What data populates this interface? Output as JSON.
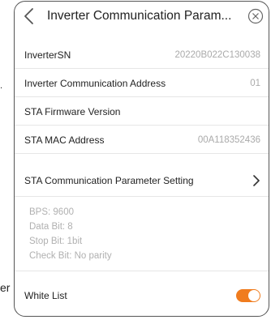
{
  "edge": {
    "dot": ".",
    "r": "er"
  },
  "header": {
    "title": "Inverter Communication Param..."
  },
  "rows": {
    "sn": {
      "label": "InverterSN",
      "value": "20220B022C130038"
    },
    "address": {
      "label": "Inverter Communication Address",
      "value": "01"
    },
    "firmware": {
      "label": "STA Firmware Version",
      "value": ""
    },
    "mac": {
      "label": "STA MAC Address",
      "value": "00A118352436"
    },
    "param_setting": {
      "label": "STA Communication Parameter Setting"
    },
    "white_list": {
      "label": "White List",
      "enabled": true
    }
  },
  "params": {
    "bps": "BPS:  9600",
    "data_bit": "Data Bit:  8",
    "stop_bit": "Stop Bit:  1bit",
    "check_bit": "Check Bit:  No parity"
  },
  "colors": {
    "accent": "#f07c1e",
    "muted": "#aaaaaa"
  },
  "icons": {
    "back": "chevron-left-icon",
    "close": "close-circle-icon",
    "next": "chevron-right-icon"
  }
}
